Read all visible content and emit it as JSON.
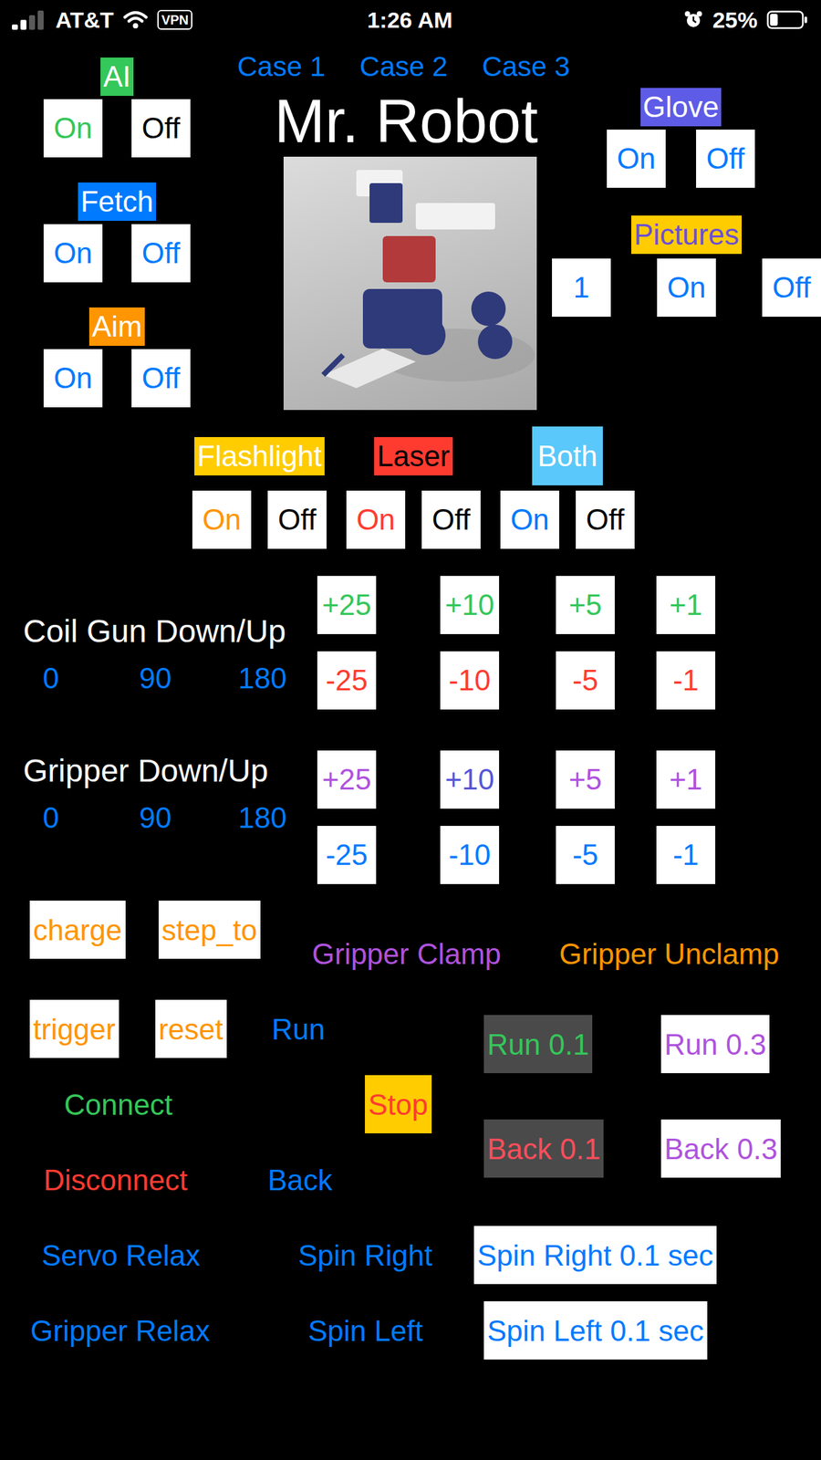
{
  "status_bar": {
    "carrier": "AT&T",
    "signal": 0.5,
    "vpn": "VPN",
    "time": "1:26 AM",
    "alarm": true,
    "battery": "25%",
    "battery_level": 0.25
  },
  "cases": [
    "Case 1",
    "Case 2",
    "Case 3"
  ],
  "title": "Mr. Robot",
  "left_toggles": [
    {
      "label": "AI",
      "background": "#34C759",
      "text_color": "#FFFFFF",
      "buttons": [
        {
          "label": "On",
          "color": "#34C759"
        },
        {
          "label": "Off",
          "color": "#000000"
        }
      ]
    },
    {
      "label": "Fetch",
      "background": "#007AFF",
      "text_color": "#FFFFFF",
      "buttons": [
        {
          "label": "On",
          "color": "#007AFF"
        },
        {
          "label": "Off",
          "color": "#007AFF"
        }
      ]
    },
    {
      "label": "Aim",
      "background": "#FF9500",
      "text_color": "#FFFFFF",
      "buttons": [
        {
          "label": "On",
          "color": "#007AFF"
        },
        {
          "label": "Off",
          "color": "#007AFF"
        }
      ]
    }
  ],
  "right_toggles": [
    {
      "label": "Glove",
      "background": "#5E5CE6",
      "text_color": "#FFFFFF",
      "buttons": [
        {
          "label": "On",
          "color": "#007AFF"
        },
        {
          "label": "Off",
          "color": "#007AFF"
        }
      ]
    },
    {
      "label": "Pictures",
      "background": "#FFCC00",
      "text_color": "#6A4FD8",
      "buttons": [
        {
          "label": "1",
          "color": "#007AFF"
        },
        {
          "label": "On",
          "color": "#007AFF"
        },
        {
          "label": "Off",
          "color": "#007AFF"
        }
      ]
    }
  ],
  "lights": [
    {
      "label": "Flashlight",
      "kind": "tag",
      "background": "#FFCC00",
      "text_color": "#FFFFFF",
      "buttons": [
        {
          "label": "On",
          "color": "#FF9500"
        },
        {
          "label": "Off",
          "color": "#000000"
        }
      ]
    },
    {
      "label": "Laser",
      "kind": "tag",
      "background": "#FF3B30",
      "text_color": "#000000",
      "buttons": [
        {
          "label": "On",
          "color": "#FF3B30"
        },
        {
          "label": "Off",
          "color": "#000000"
        }
      ]
    },
    {
      "label": "Both",
      "kind": "block",
      "background": "#5AC8FA",
      "text_color": "#FFFFFF",
      "buttons": [
        {
          "label": "On",
          "color": "#007AFF"
        },
        {
          "label": "Off",
          "color": "#000000"
        }
      ]
    }
  ],
  "servos": [
    {
      "label": "Coil Gun Down/Up",
      "presets": [
        "0",
        "90",
        "180"
      ],
      "steps": [
        [
          {
            "label": "+25",
            "color": "#34C759"
          },
          {
            "label": "+10",
            "color": "#34C759"
          },
          {
            "label": "+5",
            "color": "#34C759"
          },
          {
            "label": "+1",
            "color": "#34C759"
          }
        ],
        [
          {
            "label": "-25",
            "color": "#FF3B30"
          },
          {
            "label": "-10",
            "color": "#FF3B30"
          },
          {
            "label": "-5",
            "color": "#FF3B30"
          },
          {
            "label": "-1",
            "color": "#FF3B30"
          }
        ]
      ]
    },
    {
      "label": "Gripper Down/Up",
      "presets": [
        "0",
        "90",
        "180"
      ],
      "steps": [
        [
          {
            "label": "+25",
            "color": "#AF52DE"
          },
          {
            "label": "+10",
            "color": "#5856D6"
          },
          {
            "label": "+5",
            "color": "#AF52DE"
          },
          {
            "label": "+1",
            "color": "#AF52DE"
          }
        ],
        [
          {
            "label": "-25",
            "color": "#007AFF"
          },
          {
            "label": "-10",
            "color": "#007AFF"
          },
          {
            "label": "-5",
            "color": "#007AFF"
          },
          {
            "label": "-1",
            "color": "#007AFF"
          }
        ]
      ]
    }
  ],
  "controls": {
    "charge": {
      "label": "charge",
      "kind": "box",
      "color": "#FF9500",
      "background": "#FFFFFF"
    },
    "step_to": {
      "label": "step_to",
      "kind": "box",
      "color": "#FF9500",
      "background": "#FFFFFF"
    },
    "gripper_clamp": {
      "label": "Gripper Clamp",
      "kind": "text",
      "color": "#AF52DE"
    },
    "gripper_unclamp": {
      "label": "Gripper Unclamp",
      "kind": "text",
      "color": "#FF9500"
    },
    "trigger": {
      "label": "trigger",
      "kind": "box",
      "color": "#FF9500",
      "background": "#FFFFFF"
    },
    "reset": {
      "label": "reset",
      "kind": "box",
      "color": "#FF9500",
      "background": "#FFFFFF"
    },
    "run": {
      "label": "Run",
      "kind": "text",
      "color": "#007AFF"
    },
    "run_01": {
      "label": "Run 0.1",
      "kind": "box",
      "color": "#34C759",
      "background": "#4A4A4A"
    },
    "run_03": {
      "label": "Run 0.3",
      "kind": "box",
      "color": "#AF52DE",
      "background": "#FFFFFF"
    },
    "back_01": {
      "label": "Back 0.1",
      "kind": "box",
      "color": "#FF4D5A",
      "background": "#4A4A4A"
    },
    "back_03": {
      "label": "Back 0.3",
      "kind": "box",
      "color": "#AF52DE",
      "background": "#FFFFFF"
    },
    "connect": {
      "label": "Connect",
      "kind": "text",
      "color": "#34C759"
    },
    "stop": {
      "label": "Stop",
      "kind": "box",
      "color": "#FF3B30",
      "background": "#FFCC00"
    },
    "disconnect": {
      "label": "Disconnect",
      "kind": "text",
      "color": "#FF3B30"
    },
    "back": {
      "label": "Back",
      "kind": "text",
      "color": "#007AFF"
    },
    "servo_relax": {
      "label": "Servo Relax",
      "kind": "text",
      "color": "#007AFF"
    },
    "spin_right": {
      "label": "Spin Right",
      "kind": "text",
      "color": "#007AFF"
    },
    "spin_right_01": {
      "label": "Spin Right 0.1 sec",
      "kind": "box",
      "color": "#007AFF",
      "background": "#FFFFFF"
    },
    "gripper_relax": {
      "label": "Gripper Relax",
      "kind": "text",
      "color": "#007AFF"
    },
    "spin_left": {
      "label": "Spin Left",
      "kind": "text",
      "color": "#007AFF"
    },
    "spin_left_01": {
      "label": "Spin Left 0.1 sec",
      "kind": "box",
      "color": "#007AFF",
      "background": "#FFFFFF"
    }
  }
}
